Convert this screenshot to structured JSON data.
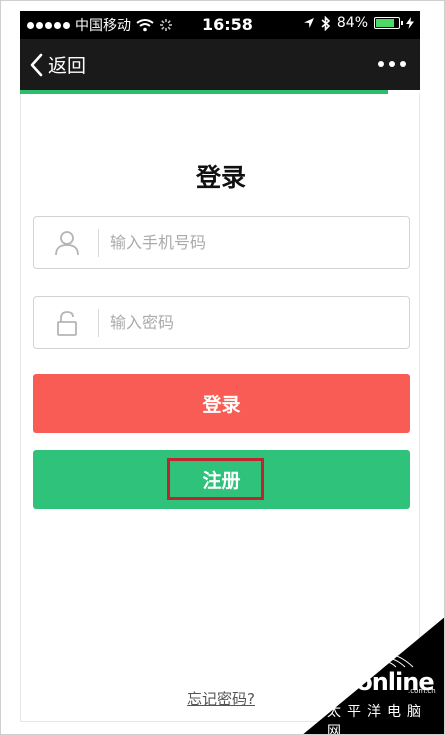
{
  "status_bar": {
    "carrier": "中国移动",
    "time": "16:58",
    "battery": "84%",
    "battery_level": 0.84
  },
  "nav": {
    "back_label": "返回"
  },
  "login": {
    "title": "登录",
    "phone_placeholder": "输入手机号码",
    "password_placeholder": "输入密码",
    "login_button": "登录",
    "register_button": "注册",
    "forgot_password": "忘记密码?"
  },
  "watermark": {
    "brand": "PConline",
    "domain": ".com.cn",
    "subtitle": "太平洋电脑网"
  },
  "colors": {
    "login_button": "#f95c55",
    "register_button": "#2fc27a",
    "highlight": "#c0242e",
    "progress": "#2bbf6a"
  },
  "icons": {
    "phone_field": "user-icon",
    "password_field": "lock-icon",
    "back": "chevron-left-icon",
    "more": "more-icon"
  }
}
